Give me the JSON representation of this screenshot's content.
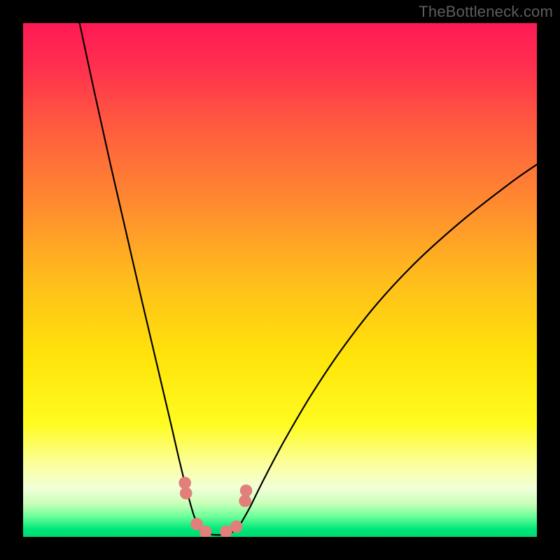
{
  "watermark": "TheBottleneck.com",
  "colors": {
    "frame": "#000000",
    "watermark": "#5d5d5d",
    "curve": "#000000",
    "markers": "#e37f7b"
  },
  "chart_data": {
    "type": "line",
    "title": "",
    "xlabel": "",
    "ylabel": "",
    "xlim": [
      0,
      100
    ],
    "ylim": [
      0,
      100
    ],
    "grid": false,
    "legend": false,
    "background_gradient_stops": [
      {
        "pos": 0.0,
        "color": "#ff1a55"
      },
      {
        "pos": 0.08,
        "color": "#ff2e4f"
      },
      {
        "pos": 0.2,
        "color": "#ff5b3f"
      },
      {
        "pos": 0.35,
        "color": "#ff8a30"
      },
      {
        "pos": 0.5,
        "color": "#ffbd1c"
      },
      {
        "pos": 0.65,
        "color": "#ffe40a"
      },
      {
        "pos": 0.78,
        "color": "#fffb20"
      },
      {
        "pos": 0.86,
        "color": "#fbffa0"
      },
      {
        "pos": 0.905,
        "color": "#f1ffd8"
      },
      {
        "pos": 0.935,
        "color": "#c9ffb8"
      },
      {
        "pos": 0.96,
        "color": "#6dff9a"
      },
      {
        "pos": 0.985,
        "color": "#00e779"
      },
      {
        "pos": 1.0,
        "color": "#00d873"
      }
    ],
    "series": [
      {
        "name": "left-branch",
        "x": [
          11.0,
          14.0,
          17.0,
          20.0,
          23.0,
          25.0,
          27.0,
          29.0,
          30.5,
          32.0,
          33.3,
          34.5
        ],
        "y": [
          100.0,
          86.0,
          72.5,
          59.5,
          46.5,
          38.0,
          29.5,
          21.0,
          14.5,
          8.5,
          4.0,
          1.5
        ]
      },
      {
        "name": "valley-floor",
        "x": [
          34.5,
          36.0,
          38.0,
          40.0,
          41.7
        ],
        "y": [
          1.5,
          0.6,
          0.4,
          0.6,
          1.5
        ]
      },
      {
        "name": "right-branch",
        "x": [
          41.7,
          44.0,
          47.0,
          51.0,
          56.0,
          62.0,
          69.0,
          77.0,
          86.0,
          95.0,
          100.0
        ],
        "y": [
          1.5,
          5.5,
          11.5,
          19.0,
          27.5,
          36.5,
          45.5,
          54.0,
          62.0,
          69.0,
          72.5
        ]
      }
    ],
    "markers": {
      "name": "highlight-points",
      "shape": "circle",
      "radius_frac": 0.012,
      "x": [
        31.5,
        31.7,
        33.8,
        35.5,
        39.5,
        41.5,
        43.2,
        43.4
      ],
      "y": [
        10.5,
        8.5,
        2.5,
        1.0,
        1.0,
        2.0,
        7.0,
        9.0
      ]
    }
  }
}
